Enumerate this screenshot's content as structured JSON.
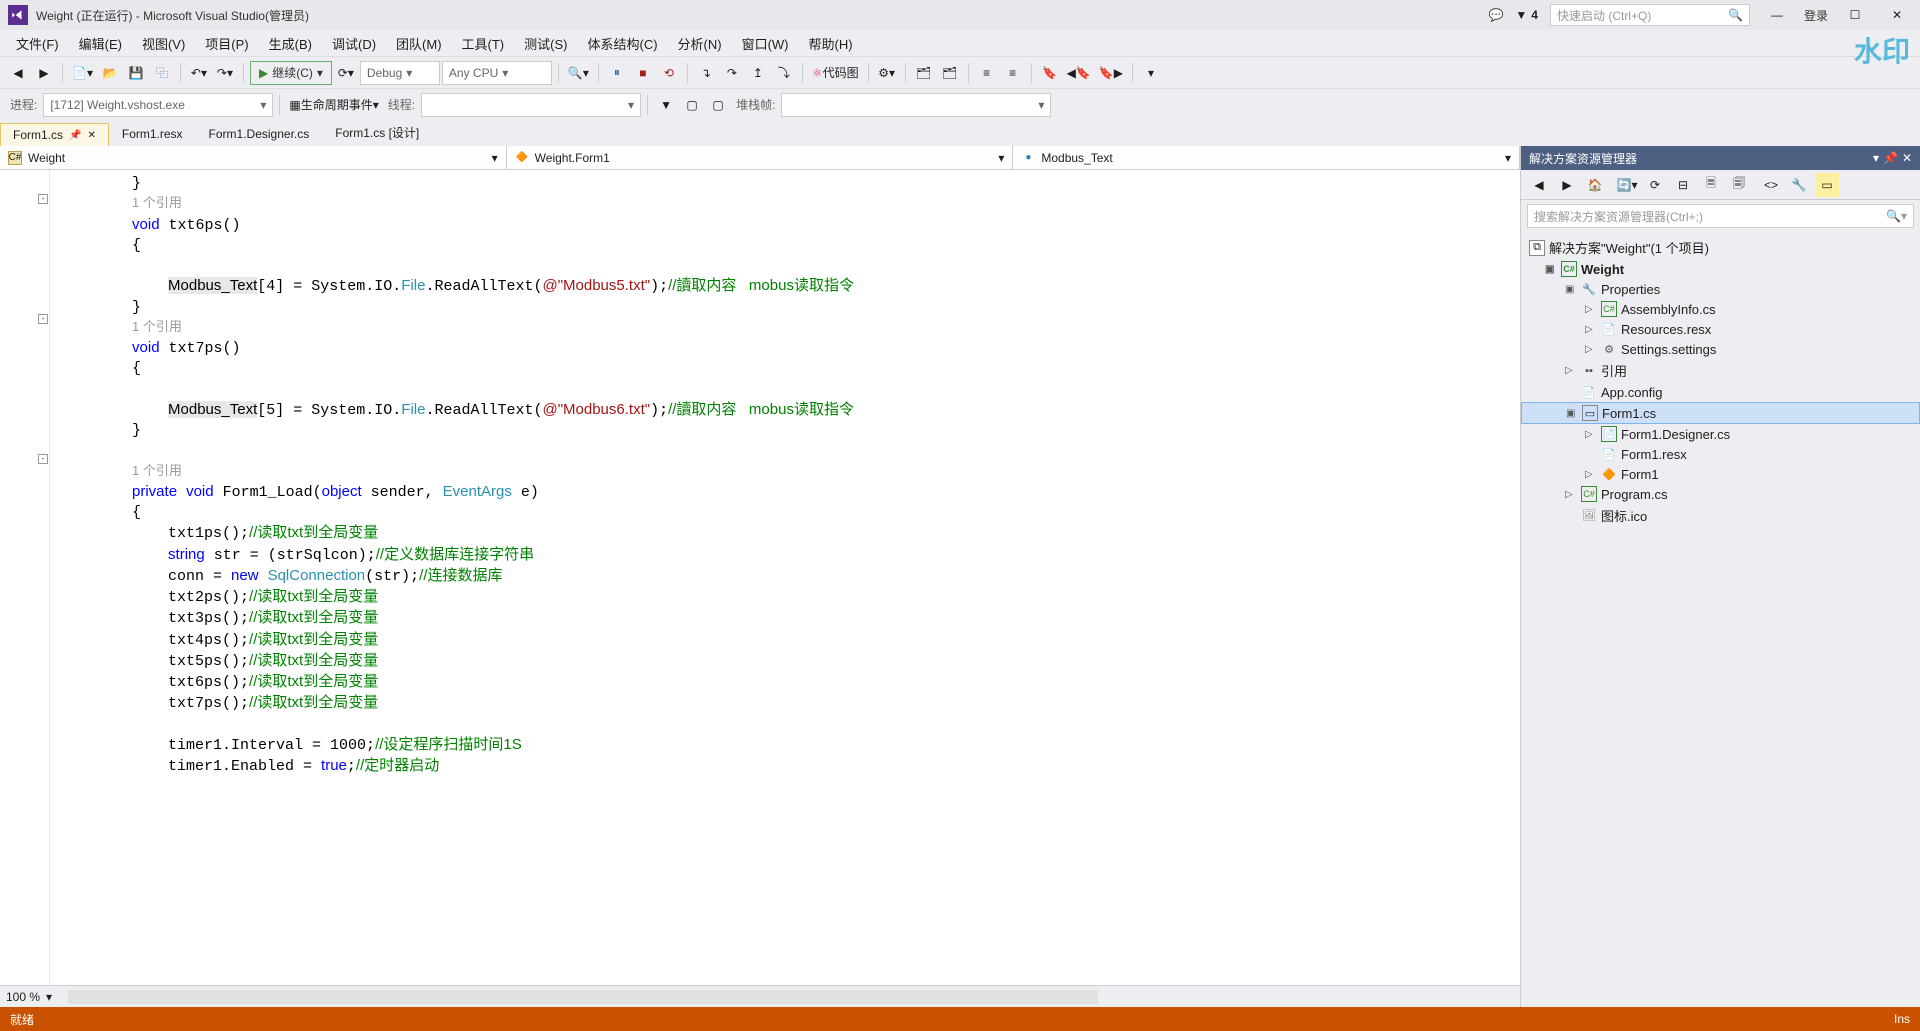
{
  "titlebar": {
    "title": "Weight (正在运行) - Microsoft Visual Studio(管理员)",
    "notif_count": "4",
    "quick_launch_placeholder": "快速启动 (Ctrl+Q)",
    "login": "登录"
  },
  "menu": [
    "文件(F)",
    "编辑(E)",
    "视图(V)",
    "项目(P)",
    "生成(B)",
    "调试(D)",
    "团队(M)",
    "工具(T)",
    "测试(S)",
    "体系结构(C)",
    "分析(N)",
    "窗口(W)",
    "帮助(H)"
  ],
  "toolbar1": {
    "continue": "继续(C)",
    "config": "Debug",
    "platform": "Any CPU",
    "codemap": "代码图"
  },
  "toolbar2": {
    "process_label": "进程:",
    "process_value": "[1712] Weight.vshost.exe",
    "lifecycle": "生命周期事件",
    "thread_label": "线程:",
    "stack_label": "堆栈帧:"
  },
  "tabs": [
    {
      "label": "Form1.cs",
      "active": true,
      "pinned": true,
      "closable": true
    },
    {
      "label": "Form1.resx",
      "active": false
    },
    {
      "label": "Form1.Designer.cs",
      "active": false
    },
    {
      "label": "Form1.cs [设计]",
      "active": false
    }
  ],
  "nav": {
    "namespace": "Weight",
    "class": "Weight.Form1",
    "member": "Modbus_Text"
  },
  "code": {
    "ref1": "1 个引用",
    "ref2": "1 个引用",
    "ref3": "1 个引用",
    "lines": [
      "        }",
      "        void txt6ps()",
      "        {",
      "",
      "            Modbus_Text[4] = System.IO.File.ReadAllText(@\"Modbus5.txt\");//讀取内容   mobus读取指令",
      "        }",
      "        void txt7ps()",
      "        {",
      "",
      "            Modbus_Text[5] = System.IO.File.ReadAllText(@\"Modbus6.txt\");//讀取内容   mobus读取指令",
      "        }",
      "",
      "        private void Form1_Load(object sender, EventArgs e)",
      "        {",
      "            txt1ps();//读取txt到全局变量",
      "            string str = (strSqlcon);//定义数据库连接字符串",
      "            conn = new SqlConnection(str);//连接数据库",
      "            txt2ps();//读取txt到全局变量",
      "            txt3ps();//读取txt到全局变量",
      "            txt4ps();//读取txt到全局变量",
      "            txt5ps();//读取txt到全局变量",
      "            txt6ps();//读取txt到全局变量",
      "            txt7ps();//读取txt到全局变量",
      "",
      "            timer1.Interval = 1000;//设定程序扫描时间1S",
      "            timer1.Enabled = true;//定时器启动"
    ]
  },
  "zoom": "100 %",
  "solution": {
    "header": "解决方案资源管理器",
    "search_placeholder": "搜索解决方案资源管理器(Ctrl+;)",
    "root": "解决方案\"Weight\"(1 个项目)",
    "project": "Weight",
    "items": {
      "properties": "Properties",
      "assemblyinfo": "AssemblyInfo.cs",
      "resources": "Resources.resx",
      "settings": "Settings.settings",
      "references": "引用",
      "appconfig": "App.config",
      "form1cs": "Form1.cs",
      "form1designer": "Form1.Designer.cs",
      "form1resx": "Form1.resx",
      "form1class": "Form1",
      "programcs": "Program.cs",
      "icon": "图标.ico"
    }
  },
  "status": {
    "left": "就绪",
    "right": "Ins"
  },
  "watermark": "水印"
}
